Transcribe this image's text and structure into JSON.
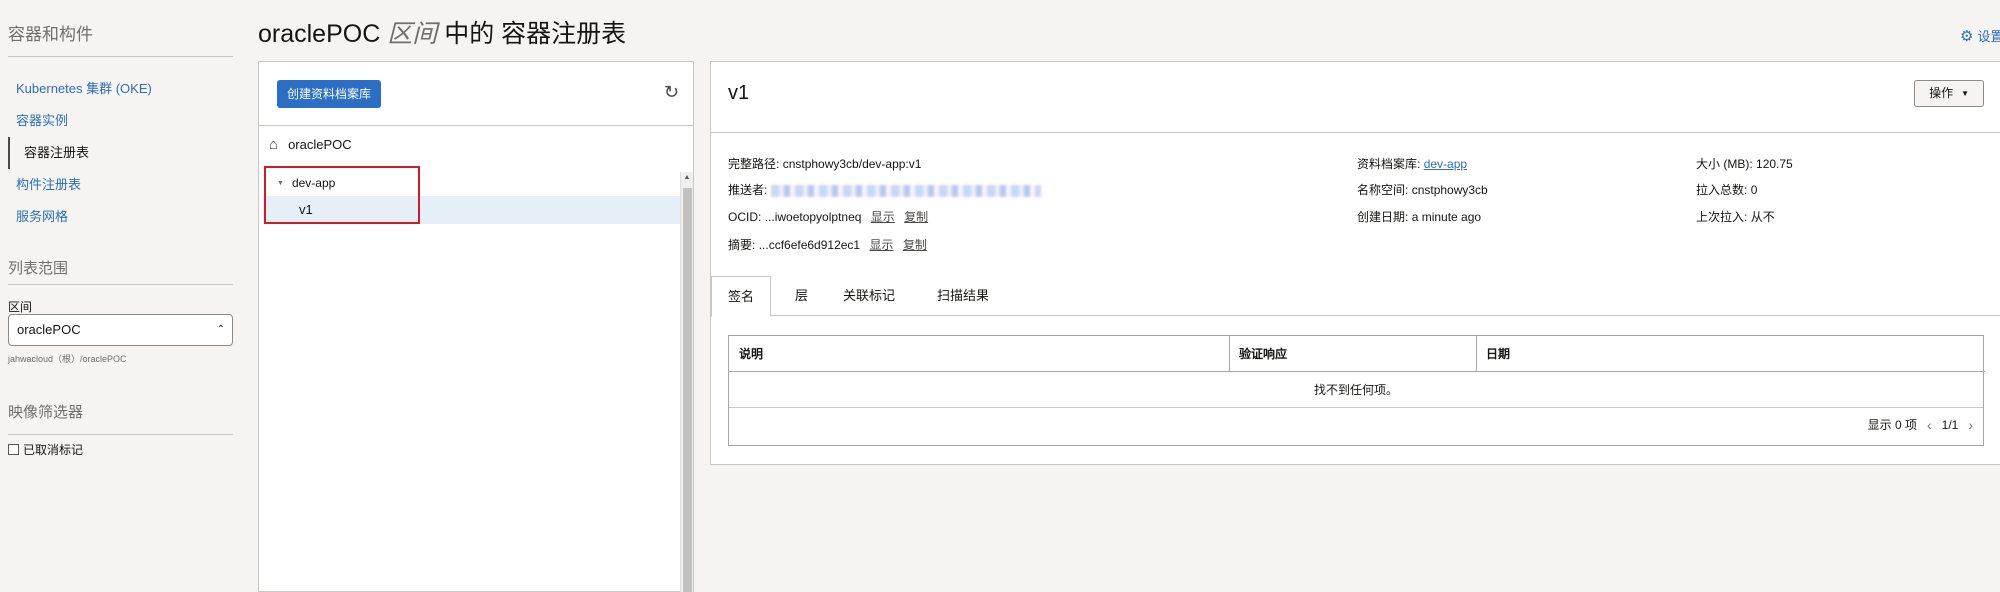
{
  "sidebar": {
    "title": "容器和构件",
    "items": [
      {
        "label": "Kubernetes 集群 (OKE)"
      },
      {
        "label": "容器实例"
      },
      {
        "label": "容器注册表"
      },
      {
        "label": "构件注册表"
      },
      {
        "label": "服务网格"
      }
    ],
    "scope_title": "列表范围",
    "compartment_label": "区间",
    "compartment_value": "oraclePOC",
    "compartment_hint": "jahwacloud（根）/oraclePOC",
    "filter_title": "映像筛选器",
    "untagged_label": "已取消标记"
  },
  "header": {
    "title_prefix": "oraclePOC",
    "title_compartment": "区间",
    "title_suffix": "中的 容器注册表",
    "settings_label": "设置"
  },
  "tree": {
    "create_button": "创建资料档案库",
    "root_label": "oraclePOC",
    "repo_label": "dev-app",
    "image_label": "v1"
  },
  "detail": {
    "title": "v1",
    "actions_label": "操作",
    "full_path_key": "完整路径:",
    "full_path_value": "cnstphowy3cb/dev-app:v1",
    "pusher_key": "推送者:",
    "ocid_key": "OCID:",
    "ocid_value": "...iwoetopyolptneq",
    "show_label": "显示",
    "copy_label": "复制",
    "digest_key": "摘要:",
    "digest_value": "...ccf6efe6d912ec1",
    "repo_key": "资料档案库:",
    "repo_value": "dev-app",
    "namespace_key": "名称空间:",
    "namespace_value": "cnstphowy3cb",
    "created_key": "创建日期:",
    "created_value": "a minute ago",
    "size_key": "大小 (MB):",
    "size_value": "120.75",
    "pulls_key": "拉入总数:",
    "pulls_value": "0",
    "last_pull_key": "上次拉入:",
    "last_pull_value": "从不"
  },
  "tabs": [
    {
      "label": "签名"
    },
    {
      "label": "层"
    },
    {
      "label": "关联标记"
    },
    {
      "label": "扫描结果"
    }
  ],
  "table": {
    "columns": [
      "说明",
      "验证响应",
      "日期"
    ],
    "empty_text": "找不到任何项。",
    "showing": "显示 0 项",
    "page": "1/1"
  },
  "colors": {
    "link": "#2d6fb8",
    "primary_button": "#2a6ec6",
    "highlight_border": "#d01c26",
    "selected_row": "#e6eef7"
  },
  "icons": [
    "home-icon",
    "refresh-icon",
    "gear-icon",
    "caret-down-icon",
    "chevron-left-icon",
    "chevron-right-icon"
  ]
}
